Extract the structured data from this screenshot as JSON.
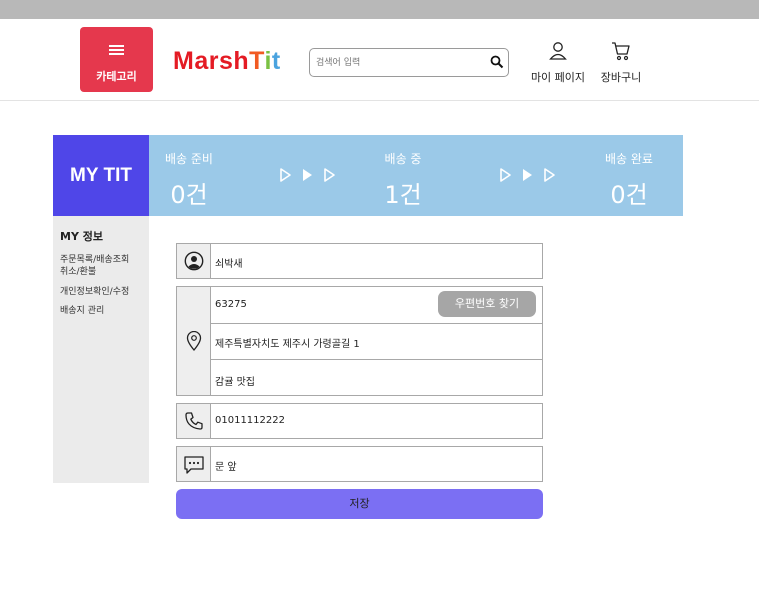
{
  "header": {
    "category_label": "카테고리",
    "logo": {
      "parts": [
        {
          "text": "Marsh",
          "color": "#e41b24"
        },
        {
          "text": "T",
          "color": "#f15a22"
        },
        {
          "text": "i",
          "color": "#7ac143"
        },
        {
          "text": "t",
          "color": "#4aa3df"
        }
      ]
    },
    "search_placeholder": "검색어 입력",
    "mypage_label": "마이 페이지",
    "cart_label": "장바구니"
  },
  "my_tit": "MY TIT",
  "delivery": {
    "stages": [
      {
        "name": "배송 준비",
        "count": "0건"
      },
      {
        "name": "배송 중",
        "count": "1건"
      },
      {
        "name": "배송 완료",
        "count": "0건"
      }
    ]
  },
  "sidebar": {
    "title": "MY 정보",
    "items": [
      "주문목록/배송조회",
      "취소/환불",
      "개인정보확인/수정",
      "배송지 관리"
    ]
  },
  "form": {
    "name": "쇠박새",
    "zipcode": "63275",
    "zip_button": "우편번호 찾기",
    "address": "제주특별자치도 제주시 가령골길 1",
    "address_detail": "감귤 맛집",
    "phone": "01011112222",
    "memo": "문 앞",
    "save_label": "저장"
  },
  "colors": {
    "category_button": "#e5384d",
    "my_tit_bg": "#4f46e8",
    "status_bg": "#9bc9e8",
    "save_button": "#7b6ff3",
    "zip_button": "#a6a6a6"
  },
  "icons": [
    "menu-icon",
    "search-icon",
    "user-icon",
    "cart-icon",
    "play-arrow-icon",
    "person-circle-icon",
    "location-pin-icon",
    "phone-icon",
    "chat-bubble-icon"
  ]
}
